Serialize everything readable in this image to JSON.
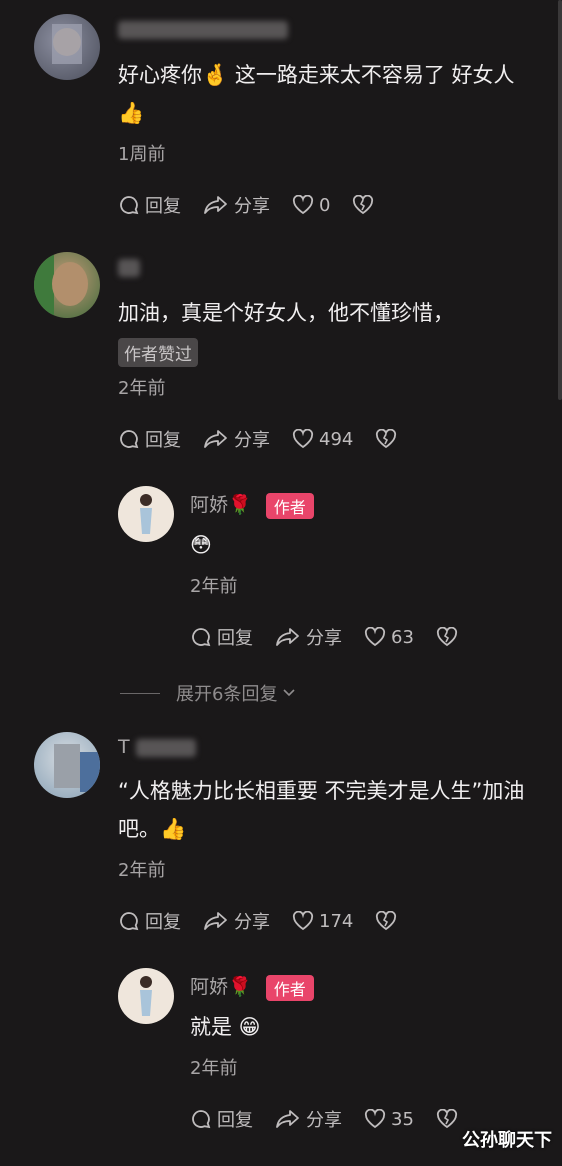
{
  "comments": [
    {
      "text": "好心疼你🤞 这一路走来太不容易了 好女人👍",
      "time": "1周前",
      "reply": "回复",
      "share": "分享",
      "likes": "0"
    },
    {
      "text": "加油，真是个好女人，他不懂珍惜，",
      "badge": "作者赞过",
      "time": "2年前",
      "reply": "回复",
      "share": "分享",
      "likes": "494",
      "sub": {
        "username": "阿娇🌹",
        "author_badge": "作者",
        "text": "😳",
        "time": "2年前",
        "reply": "回复",
        "share": "分享",
        "likes": "63"
      }
    },
    {
      "username_initial": "T",
      "text": "“人格魅力比长相重要 不完美才是人生”加油吧。👍",
      "time": "2年前",
      "reply": "回复",
      "share": "分享",
      "likes": "174",
      "sub": {
        "username": "阿娇🌹",
        "author_badge": "作者",
        "text": "就是 😁",
        "time": "2年前",
        "reply": "回复",
        "share": "分享",
        "likes": "35"
      }
    }
  ],
  "expand_text": "展开6条回复",
  "watermark": "公孙聊天下"
}
